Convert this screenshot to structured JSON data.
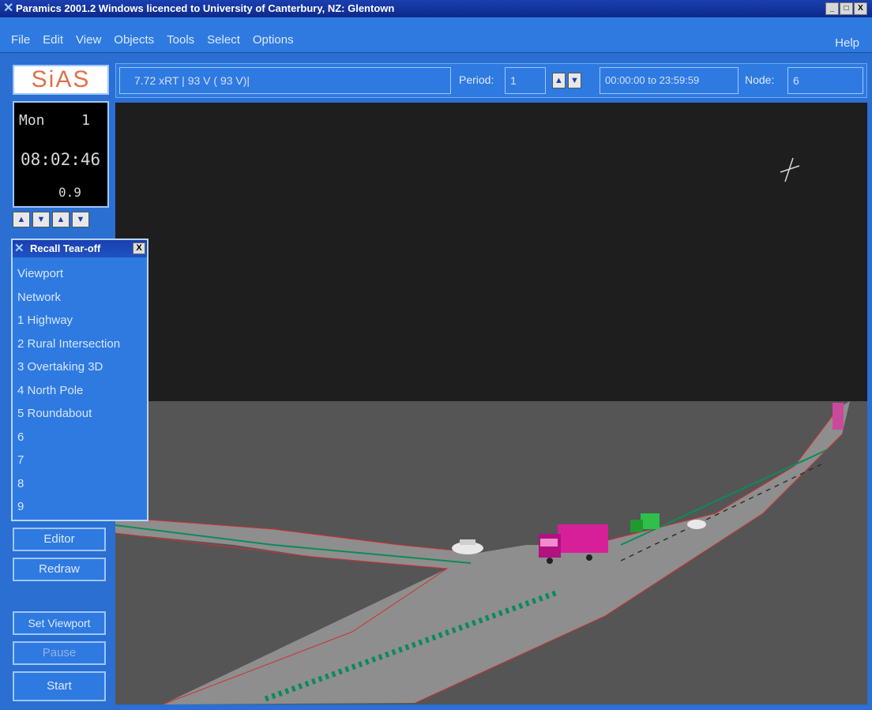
{
  "window": {
    "title": "Paramics 2001.2 Windows licenced to University of Canterbury, NZ: Glentown",
    "minimize": "_",
    "maximize": "□",
    "close": "X"
  },
  "menu": {
    "items": [
      "File",
      "Edit",
      "View",
      "Objects",
      "Tools",
      "Select",
      "Options"
    ],
    "help": "Help"
  },
  "logo": {
    "text": "SiAS"
  },
  "status": {
    "rate": "7.72 xRT |   93 V (   93 V)|",
    "period_label": "Period:",
    "period_value": "1",
    "time_range": "00:00:00 to 23:59:59",
    "node_label": "Node:",
    "node_value": "6"
  },
  "clock": {
    "day": "Mon",
    "day_number": "1",
    "time": "08:02:46",
    "speed": "0.9"
  },
  "icons": {
    "up": "▲",
    "down": "▼"
  },
  "recall": {
    "title": "Recall Tear-off",
    "close": "X",
    "items": [
      "Viewport",
      "Network",
      "1 Highway",
      "2 Rural Intersection",
      "3 Overtaking 3D",
      "4 North Pole",
      "5 Roundabout",
      "6",
      "7",
      "8",
      "9"
    ]
  },
  "buttons": {
    "editor": "Editor",
    "redraw": "Redraw",
    "set_viewport": "Set Viewport",
    "pause": "Pause",
    "start": "Start"
  },
  "colors": {
    "panel": "#2f7ae0",
    "titlebar": "#1a3fb0",
    "road": "#8e8e8e",
    "ground": "#555555",
    "sky": "#1e1e1e",
    "truck": "#d81f9a",
    "green_car": "#2fbf4a",
    "lane_marking": "#0d8a5a",
    "road_edge": "#d03030"
  }
}
